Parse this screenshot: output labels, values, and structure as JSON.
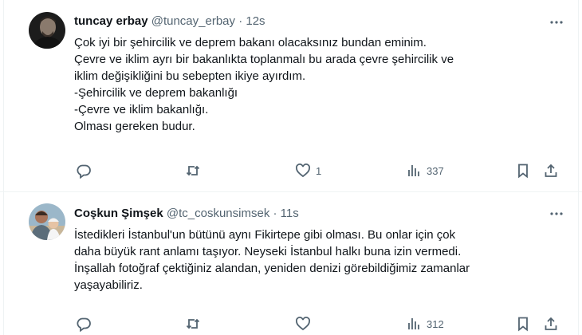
{
  "tweets": [
    {
      "name": "tuncay erbay",
      "handle": "@tuncay_erbay",
      "separator": "·",
      "time": "12s",
      "lines": [
        "Çok iyi bir şehircilik ve deprem bakanı olacaksınız bundan eminim.",
        "Çevre ve iklim ayrı bir bakanlıkta toplanmalı bu arada çevre şehircilik ve",
        "iklim değişikliğini bu sebepten ikiye ayırdım.",
        "-Şehircilik ve deprem bakanlığı",
        "-Çevre ve iklim bakanlığı.",
        "Olması gereken budur."
      ],
      "replies": "",
      "retweets": "",
      "likes": "1",
      "views": "337"
    },
    {
      "name": "Coşkun Şimşek",
      "handle": "@tc_coskunsimsek",
      "separator": "·",
      "time": "11s",
      "lines": [
        "İstedikleri İstanbul'un bütünü aynı Fikirtepe gibi olması. Bu onlar için çok",
        "daha büyük rant anlamı taşıyor. Neyseki İstanbul halkı buna izin vermedi.",
        "İnşallah fotoğraf çektiğiniz alandan, yeniden denizi görebildiğimiz zamanlar",
        "yaşayabiliriz."
      ],
      "replies": "",
      "retweets": "",
      "likes": "",
      "views": "312"
    }
  ],
  "colors": {
    "text": "#0f1419",
    "secondary": "#536471",
    "border": "#eff3f4"
  },
  "icons": [
    "more-icon",
    "reply-icon",
    "retweet-icon",
    "like-icon",
    "views-icon",
    "bookmark-icon",
    "share-icon"
  ]
}
